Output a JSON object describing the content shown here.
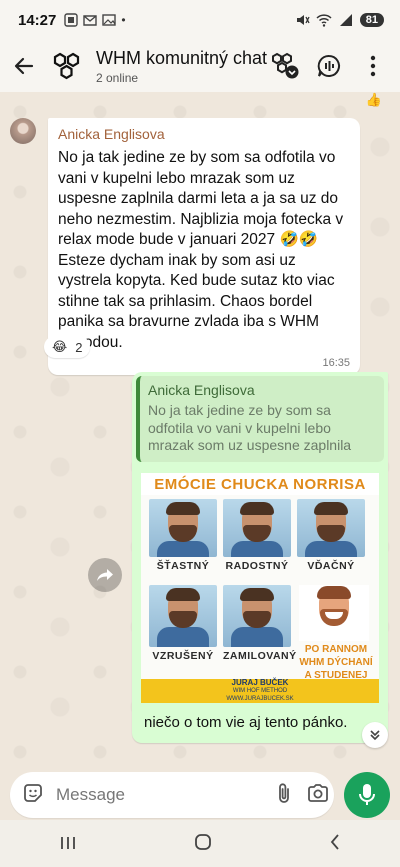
{
  "status_bar": {
    "time": "14:27",
    "battery": "81"
  },
  "header": {
    "title": "WHM komunitný chat",
    "subtitle": "2 online"
  },
  "icons": {
    "back": "arrow-left-icon",
    "group_avatar": "hexagon-group-icon",
    "community": "community-icon",
    "call": "chat-call-icon",
    "menu": "more-vert-icon",
    "sticker": "sticker-icon",
    "attach": "paperclip-icon",
    "camera": "camera-icon",
    "mic": "mic-icon",
    "forward": "forward-icon",
    "scroll_down": "double-chevron-down-icon"
  },
  "top_reaction": "👍",
  "incoming_message": {
    "sender": "Anicka Englisova",
    "text": "No ja tak jedine ze by som sa odfotila vo vani v kupelni lebo mrazak som uz uspesne zaplnila darmi leta a ja sa uz do neho nezmestim. Najblizia moja fotecka v relax mode bude v januari 2027 🤣🤣 Esteze dycham inak by som asi uz vystrela kopyta. Ked bude sutaz kto viac stihne tak sa prihlasim. Chaos bordel panika sa bravurne zvlada iba s WHM metodou.",
    "time": "16:35",
    "reaction_emoji": "😂",
    "reaction_count": "2"
  },
  "outgoing_message": {
    "quoted_sender": "Anicka Englisova",
    "quoted_text": "No ja tak jedine ze by som sa odfotila vo vani v kupelni lebo mrazak som uz uspesne zaplnila darmi leta a ja sa u…",
    "caption": "niečo o tom vie aj tento pánko."
  },
  "poster": {
    "title": "EMÓCIE CHUCKA NORRISA",
    "labels": [
      "ŠŤASTNÝ",
      "RADOSTNÝ",
      "VĎAČNÝ",
      "VZRUŠENÝ",
      "ZAMILOVANÝ"
    ],
    "side_text": "PO RANNOM WHM DÝCHANÍ A STUDENEJ SPRCHE",
    "footer_name": "JURAJ BUČEK",
    "footer_sub": "WIM HOF METHOD",
    "footer_url": "WWW.JURAJBUCEK.SK"
  },
  "composer": {
    "placeholder": "Message"
  },
  "colors": {
    "accent": "#1aa25c",
    "outgoing_bubble": "#d9fdd3",
    "sender_name": "#a2623b",
    "poster_orange": "#e08a1a"
  }
}
